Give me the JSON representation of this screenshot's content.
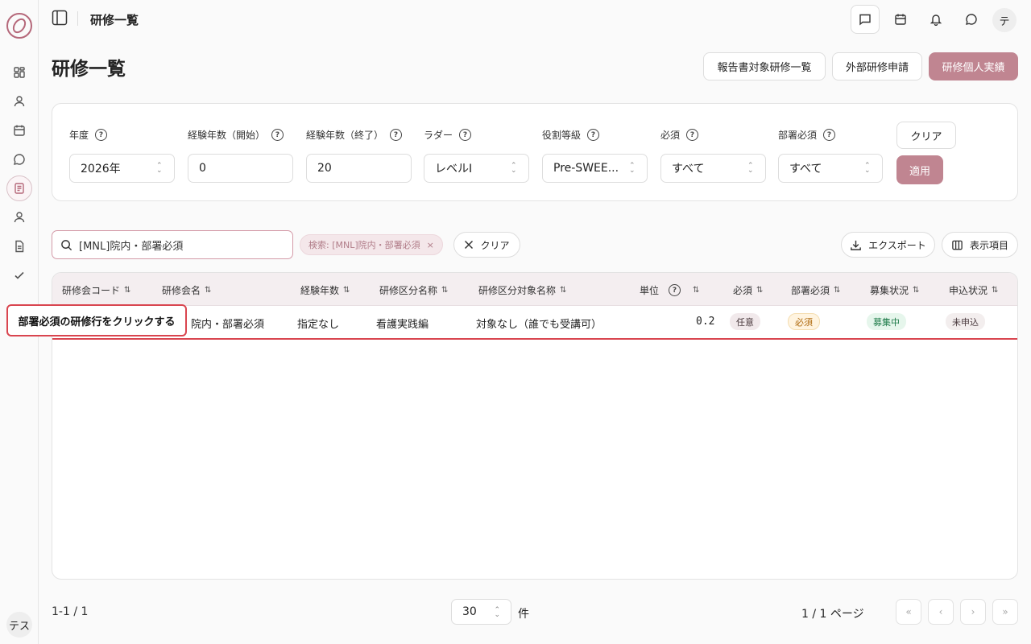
{
  "topbar": {
    "breadcrumb": "研修一覧",
    "avatar": "テ"
  },
  "rail": {
    "user": "テス"
  },
  "page": {
    "title": "研修一覧"
  },
  "header_buttons": {
    "report": "報告書対象研修一覧",
    "external": "外部研修申請",
    "personal": "研修個人実績"
  },
  "filters": {
    "year": {
      "label": "年度",
      "value": "2026年"
    },
    "exp_start": {
      "label": "経験年数（開始）",
      "value": "0"
    },
    "exp_end": {
      "label": "経験年数（終了）",
      "value": "20"
    },
    "ladder": {
      "label": "ラダー",
      "value": "レベルI"
    },
    "role": {
      "label": "役割等級",
      "value": "Pre-SWEE..."
    },
    "required": {
      "label": "必須",
      "value": "すべて"
    },
    "dept_required": {
      "label": "部署必須",
      "value": "すべて"
    },
    "help": "?",
    "clear": "クリア",
    "apply": "適用"
  },
  "toolbar": {
    "search_value": "[MNL]院内・部署必須",
    "chip": "検索: [MNL]院内・部署必須",
    "chip_close": "×",
    "clear": "クリア",
    "export": "エクスポート",
    "columns": "表示項目"
  },
  "table": {
    "headers": [
      "研修会コード",
      "研修会名",
      "経験年数",
      "研修区分名称",
      "研修区分対象名称",
      "単位",
      "必須",
      "部署必須",
      "募集状況",
      "申込状況"
    ],
    "sort_icon": "⇅",
    "rows": [
      {
        "code": "",
        "name": "院内・部署必須",
        "experience": "指定なし",
        "category": "看護実践編",
        "target": "対象なし（誰でも受講可）",
        "unit": "0.2",
        "required": "任意",
        "dept_required": "必須",
        "recruit": "募集中",
        "apply": "未申込"
      }
    ]
  },
  "tooltip": "部署必須の研修行をクリックする",
  "footer": {
    "count": "1-1 / 1",
    "page_size": "30",
    "unit": "件",
    "page_info": "1 / 1 ページ",
    "first": "«",
    "prev": "‹",
    "next": "›",
    "last": "»"
  }
}
